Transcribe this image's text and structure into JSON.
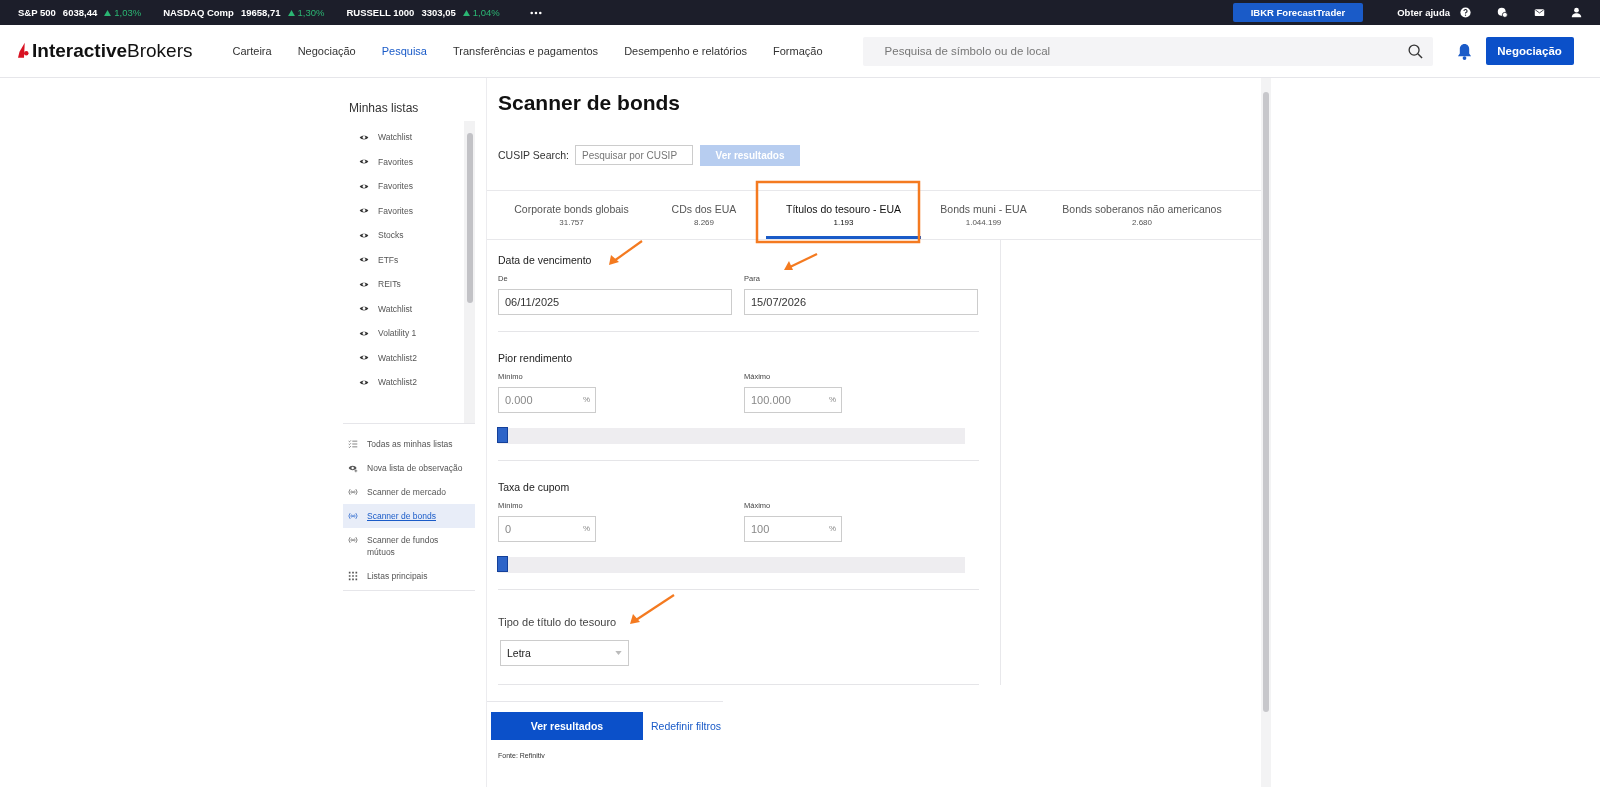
{
  "ticker": [
    {
      "name": "S&P 500",
      "value": "6038,44",
      "change": "1,03%",
      "up": true
    },
    {
      "name": "NASDAQ Comp",
      "value": "19658,71",
      "change": "1,30%",
      "up": true
    },
    {
      "name": "RUSSELL 1000",
      "value": "3303,05",
      "change": "1,04%",
      "up": true
    }
  ],
  "top_links": {
    "promo": "IBKR ForecastTrader",
    "help": "Obter ajuda"
  },
  "brand": {
    "bold": "Interactive",
    "light": "Brokers"
  },
  "nav": [
    {
      "label": "Carteira",
      "selected": false
    },
    {
      "label": "Negociação",
      "selected": false
    },
    {
      "label": "Pesquisa",
      "selected": true
    },
    {
      "label": "Transferências e pagamentos",
      "selected": false
    },
    {
      "label": "Desempenho e relatórios",
      "selected": false
    },
    {
      "label": "Formação",
      "selected": false
    }
  ],
  "search": {
    "placeholder": "Pesquisa de símbolo ou de local"
  },
  "trade_button": "Negociação",
  "sidebar": {
    "title": "Minhas listas",
    "lists": [
      "Watchlist",
      "Favorites",
      "Favorites",
      "Favorites",
      "Stocks",
      "ETFs",
      "REITs",
      "Watchlist",
      "Volatility 1",
      "Watchlist2",
      "Watchlist2"
    ],
    "links": [
      {
        "label": "Todas as minhas listas",
        "kind": "checklist",
        "selected": false
      },
      {
        "label": "Nova lista de observação",
        "kind": "addwatch",
        "selected": false
      },
      {
        "label": "Scanner de mercado",
        "kind": "scanner",
        "selected": false
      },
      {
        "label": "Scanner de bonds",
        "kind": "scanner",
        "selected": true
      },
      {
        "label": "Scanner de fundos mútuos",
        "kind": "scanner",
        "selected": false
      },
      {
        "label": "Listas principais",
        "kind": "grid",
        "selected": false
      }
    ]
  },
  "page_title": "Scanner de bonds",
  "cusip": {
    "label": "CUSIP Search:",
    "placeholder": "Pesquisar por CUSIP",
    "button": "Ver resultados",
    "disabled": true
  },
  "tabs": [
    {
      "label": "Corporate bonds globais",
      "count": "31.757",
      "selected": false
    },
    {
      "label": "CDs dos EUA",
      "count": "8.269",
      "selected": false
    },
    {
      "label": "Títulos do tesouro - EUA",
      "count": "1.193",
      "selected": true
    },
    {
      "label": "Bonds muni - EUA",
      "count": "1.044.199",
      "selected": false
    },
    {
      "label": "Bonds soberanos não americanos",
      "count": "2.680",
      "selected": false
    }
  ],
  "maturity": {
    "title": "Data de vencimento",
    "from_label": "De",
    "from": "06/11/2025",
    "to_label": "Para",
    "to": "15/07/2026"
  },
  "ranges": [
    {
      "title": "Pior rendimento",
      "min_label": "Mínimo",
      "min": "0.000",
      "max_label": "Máximo",
      "max": "100.000",
      "unit": "%",
      "level": 0
    },
    {
      "title": "Taxa de cupom",
      "min_label": "Mínimo",
      "min": "0",
      "max_label": "Máximo",
      "max": "100",
      "unit": "%",
      "level": 0
    }
  ],
  "treasury_type": {
    "title": "Tipo de título do tesouro",
    "value": "Letra"
  },
  "results_button": "Ver resultados",
  "reset_link": "Redefinir filtros",
  "source": "Fonte: Refinitiv"
}
